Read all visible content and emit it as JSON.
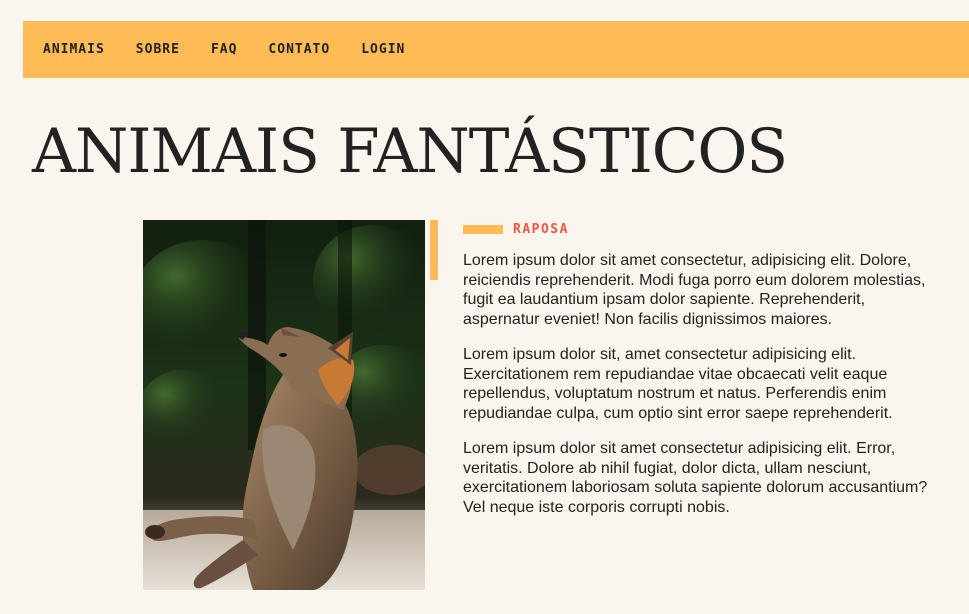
{
  "menu": {
    "items": [
      {
        "label": "ANIMAIS"
      },
      {
        "label": "SOBRE"
      },
      {
        "label": "FAQ"
      },
      {
        "label": "CONTATO"
      },
      {
        "label": "LOGIN"
      }
    ]
  },
  "page": {
    "title": "ANIMAIS FANTÁSTICOS"
  },
  "animal": {
    "name": "RAPOSA",
    "paragraphs": [
      "Lorem ipsum dolor sit amet consectetur, adipisicing elit. Dolore, reiciendis reprehenderit. Modi fuga porro eum dolorem molestias, fugit ea laudantium ipsam dolor sapiente. Reprehenderit, aspernatur eveniet! Non facilis dignissimos maiores.",
      "Lorem ipsum dolor sit, amet consectetur adipisicing elit. Exercitationem rem repudiandae vitae obcaecati velit eaque repellendus, voluptatum nostrum et natus. Perferendis enim repudiandae culpa, cum optio sint error saepe reprehenderit.",
      "Lorem ipsum dolor sit amet consectetur adipisicing elit. Error, veritatis. Dolore ab nihil fugiat, dolor dicta, ullam nesciunt, exercitationem laboriosam soluta sapiente dolorum accusantium? Vel neque iste corporis corrupti nobis."
    ]
  },
  "colors": {
    "accent": "#FFBB55",
    "heading": "#EE5544",
    "background": "#FAF6ED",
    "text": "#222222"
  }
}
